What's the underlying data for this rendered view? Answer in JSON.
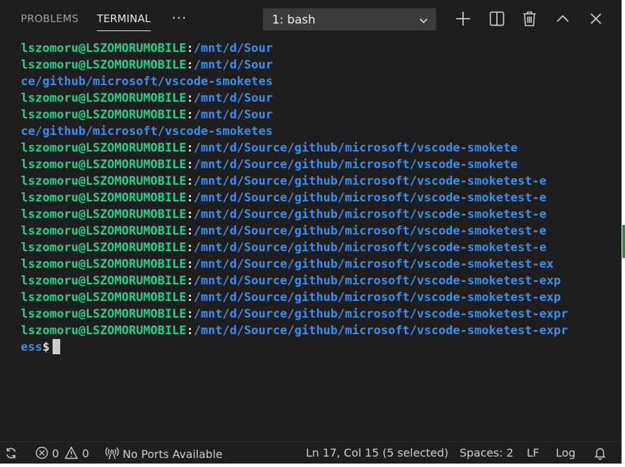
{
  "panel": {
    "tabs": [
      {
        "label": "PROBLEMS",
        "active": false
      },
      {
        "label": "TERMINAL",
        "active": true
      }
    ],
    "more_icon": "ellipsis-icon",
    "terminal_select": {
      "value": "1: bash"
    },
    "actions": [
      {
        "icon": "plus-icon",
        "name": "new-terminal"
      },
      {
        "icon": "split-icon",
        "name": "split-terminal"
      },
      {
        "icon": "trash-icon",
        "name": "kill-terminal"
      },
      {
        "icon": "chevron-up-icon",
        "name": "maximize-panel"
      },
      {
        "icon": "close-icon",
        "name": "close-panel"
      }
    ]
  },
  "terminal": {
    "colors": {
      "user": "#23d18b",
      "path": "#3b8eea",
      "text": "#dddddd"
    },
    "lines": [
      {
        "user": "lszomoru@LSZOMORUMOBILE",
        "sep": ":",
        "path": "/mnt/d/Sour"
      },
      {
        "user": "lszomoru@LSZOMORUMOBILE",
        "sep": ":",
        "path": "/mnt/d/Sour"
      },
      {
        "user": "",
        "sep": "",
        "path": "ce/github/microsoft/vscode-smoketes"
      },
      {
        "user": "lszomoru@LSZOMORUMOBILE",
        "sep": ":",
        "path": "/mnt/d/Sour"
      },
      {
        "user": "lszomoru@LSZOMORUMOBILE",
        "sep": ":",
        "path": "/mnt/d/Sour"
      },
      {
        "user": "",
        "sep": "",
        "path": "ce/github/microsoft/vscode-smoketes"
      },
      {
        "user": "lszomoru@LSZOMORUMOBILE",
        "sep": ":",
        "path": "/mnt/d/Source/github/microsoft/vscode-smokete"
      },
      {
        "user": "lszomoru@LSZOMORUMOBILE",
        "sep": ":",
        "path": "/mnt/d/Source/github/microsoft/vscode-smokete"
      },
      {
        "user": "lszomoru@LSZOMORUMOBILE",
        "sep": ":",
        "path": "/mnt/d/Source/github/microsoft/vscode-smoketest-e"
      },
      {
        "user": "lszomoru@LSZOMORUMOBILE",
        "sep": ":",
        "path": "/mnt/d/Source/github/microsoft/vscode-smoketest-e"
      },
      {
        "user": "lszomoru@LSZOMORUMOBILE",
        "sep": ":",
        "path": "/mnt/d/Source/github/microsoft/vscode-smoketest-e"
      },
      {
        "user": "lszomoru@LSZOMORUMOBILE",
        "sep": ":",
        "path": "/mnt/d/Source/github/microsoft/vscode-smoketest-e"
      },
      {
        "user": "lszomoru@LSZOMORUMOBILE",
        "sep": ":",
        "path": "/mnt/d/Source/github/microsoft/vscode-smoketest-e"
      },
      {
        "user": "lszomoru@LSZOMORUMOBILE",
        "sep": ":",
        "path": "/mnt/d/Source/github/microsoft/vscode-smoketest-ex"
      },
      {
        "user": "lszomoru@LSZOMORUMOBILE",
        "sep": ":",
        "path": "/mnt/d/Source/github/microsoft/vscode-smoketest-exp"
      },
      {
        "user": "lszomoru@LSZOMORUMOBILE",
        "sep": ":",
        "path": "/mnt/d/Source/github/microsoft/vscode-smoketest-exp"
      },
      {
        "user": "lszomoru@LSZOMORUMOBILE",
        "sep": ":",
        "path": "/mnt/d/Source/github/microsoft/vscode-smoketest-expr"
      },
      {
        "user": "lszomoru@LSZOMORUMOBILE",
        "sep": ":",
        "path": "/mnt/d/Source/github/microsoft/vscode-smoketest-expr"
      }
    ],
    "prompt": {
      "path": "ess",
      "symbol": "$"
    }
  },
  "status_bar": {
    "sync_icon": "sync-icon",
    "errors": "0",
    "warnings": "0",
    "ports": "No Ports Available",
    "position": "Ln 17, Col 15 (5 selected)",
    "spaces": "Spaces: 2",
    "eol": "LF",
    "language": "Log",
    "bell_icon": "bell-icon"
  }
}
